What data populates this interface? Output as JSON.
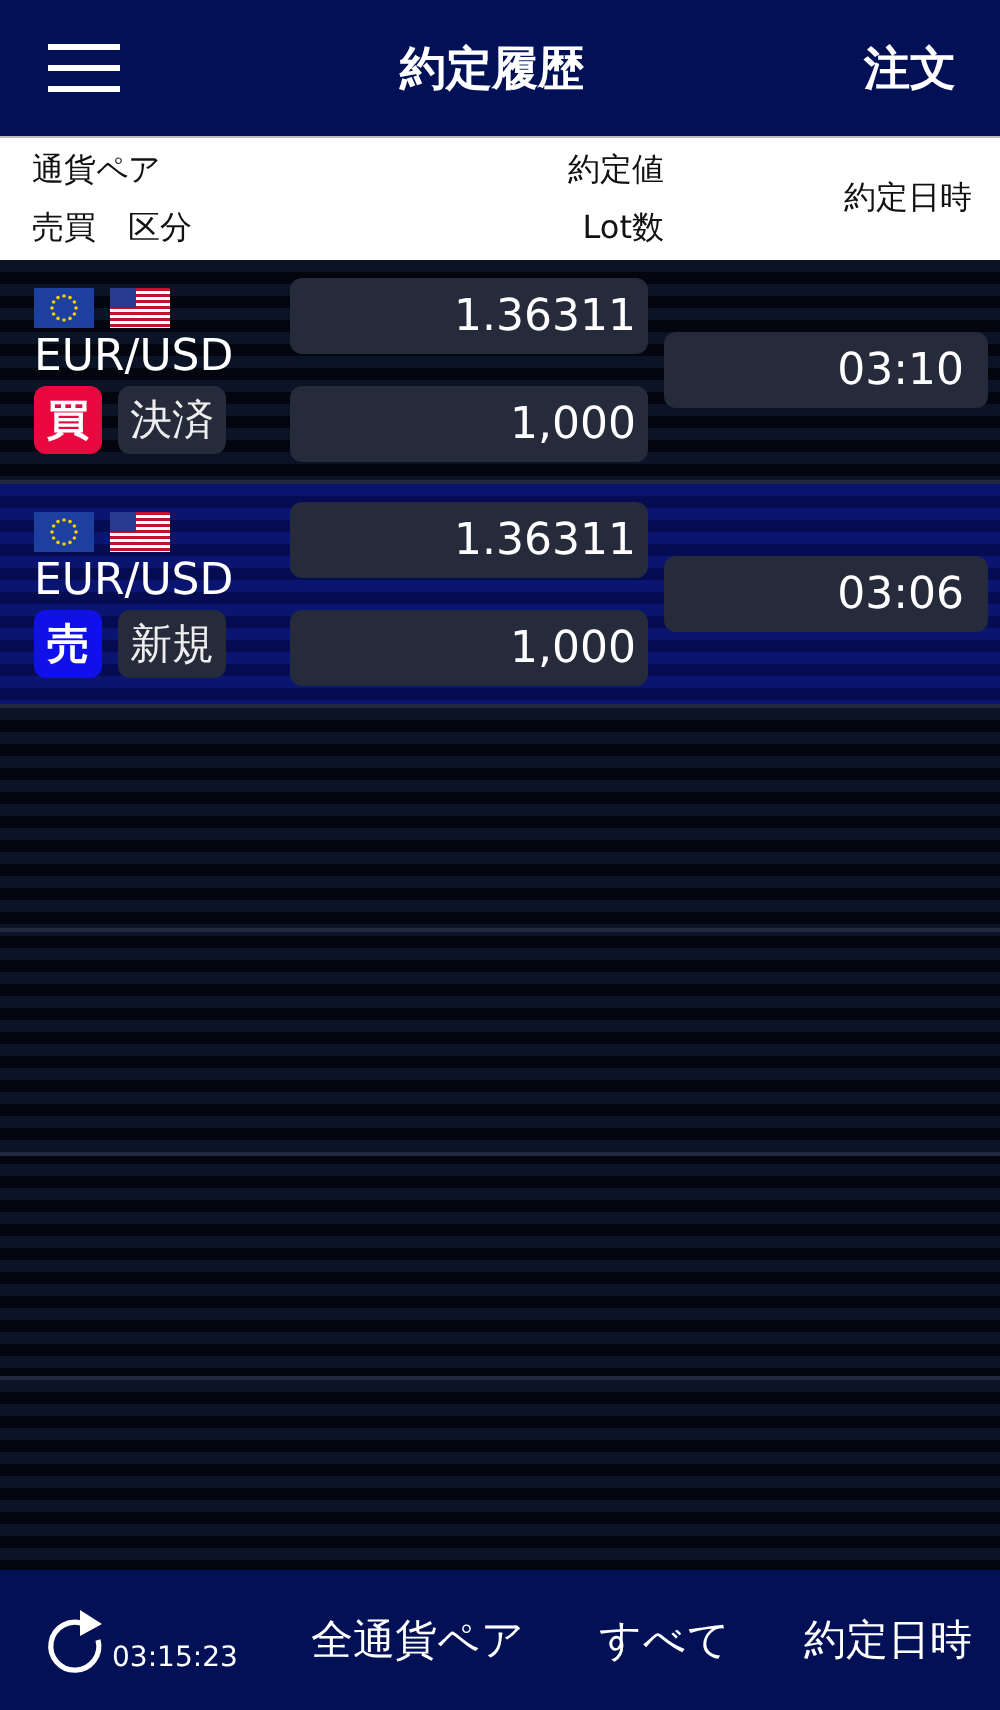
{
  "header": {
    "title": "約定履歴",
    "order_button": "注文"
  },
  "columns": {
    "pair": "通貨ペア",
    "side_type": "売買　区分",
    "price": "約定値",
    "lots": "Lot数",
    "time": "約定日時"
  },
  "trades": [
    {
      "pair": "EUR/USD",
      "side": "買",
      "kind": "buy",
      "type": "決済",
      "price": "1.36311",
      "lots": "1,000",
      "time": "03:10",
      "selected": false
    },
    {
      "pair": "EUR/USD",
      "side": "売",
      "kind": "sell",
      "type": "新規",
      "price": "1.36311",
      "lots": "1,000",
      "time": "03:06",
      "selected": true
    }
  ],
  "footer": {
    "updated": "03:15:23",
    "pair_filter": "全通貨ペア",
    "type_filter": "すべて",
    "sort": "約定日時"
  }
}
